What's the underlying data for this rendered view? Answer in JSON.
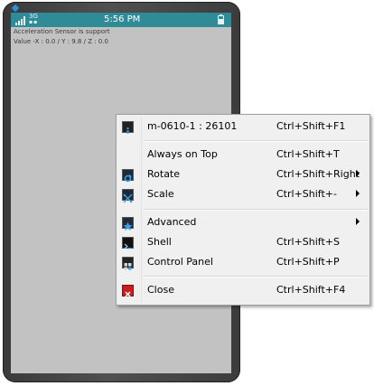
{
  "status_bar": {
    "network": "3G",
    "time": "5:56 PM"
  },
  "screen": {
    "line1": "Acceleration Sensor is support",
    "line2": "Value -X : 0.0 / Y : 9.8 / Z : 0.0"
  },
  "menu": {
    "items": [
      {
        "label": "m-0610-1 : 26101",
        "shortcut": "Ctrl+Shift+F1",
        "icon": "info-icon"
      },
      {
        "label": "Always on Top",
        "shortcut": "Ctrl+Shift+T"
      },
      {
        "label": "Rotate",
        "shortcut": "Ctrl+Shift+Right",
        "icon": "rotate-icon",
        "submenu": true
      },
      {
        "label": "Scale",
        "shortcut": "Ctrl+Shift+-",
        "icon": "scale-icon",
        "submenu": true
      },
      {
        "label": "Advanced",
        "icon": "advanced-star-icon",
        "submenu": true
      },
      {
        "label": "Shell",
        "shortcut": "Ctrl+Shift+S",
        "icon": "shell-terminal-icon"
      },
      {
        "label": "Control Panel",
        "shortcut": "Ctrl+Shift+P",
        "icon": "control-panel-icon"
      },
      {
        "label": "Close",
        "shortcut": "Ctrl+Shift+F4",
        "icon": "close-icon"
      }
    ]
  },
  "colors": {
    "status_bar": "#2f8b98",
    "screen": "#c2c2c2",
    "menu_bg": "#f0f0f0",
    "device_frame": "#444444"
  }
}
